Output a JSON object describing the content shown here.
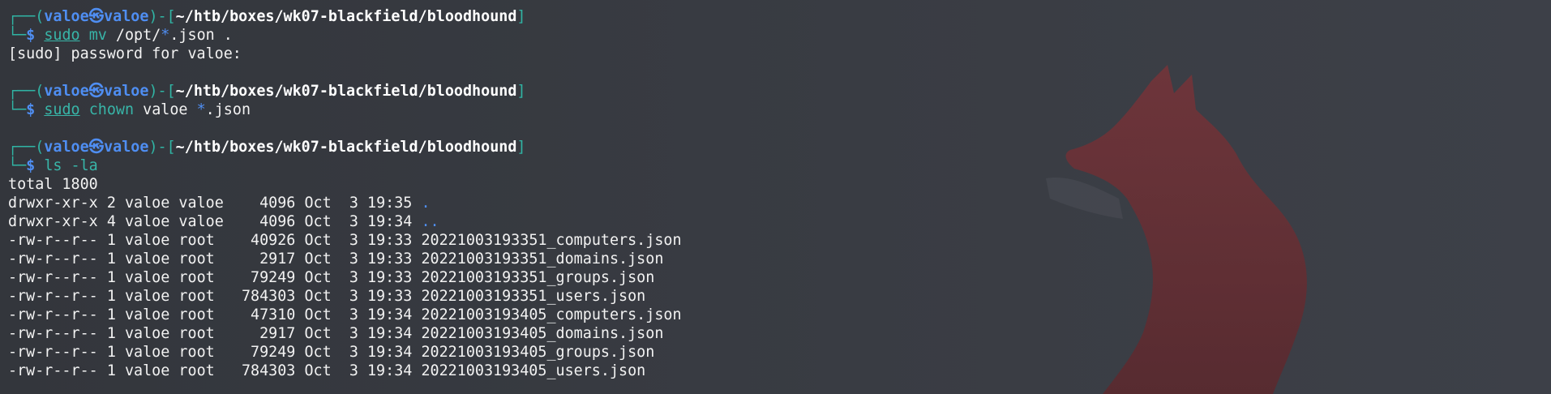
{
  "prompt": {
    "corner_top": "┌──(",
    "user": "valoe",
    "at_symbol": "㉿",
    "host": "valoe",
    "mid": ")-[",
    "cwd": "~/htb/boxes/wk07-blackfield/bloodhound",
    "end": "]",
    "corner_bottom": "└─",
    "dollar": "$ "
  },
  "commands": [
    {
      "parts": [
        {
          "text": "sudo",
          "style": "cmd-ul"
        },
        {
          "text": " ",
          "style": "text"
        },
        {
          "text": "mv",
          "style": "cmd"
        },
        {
          "text": " /opt/",
          "style": "text"
        },
        {
          "text": "*",
          "style": "glob"
        },
        {
          "text": ".json .",
          "style": "text"
        }
      ],
      "output": [
        "[sudo] password for valoe:",
        ""
      ]
    },
    {
      "parts": [
        {
          "text": "sudo",
          "style": "cmd-ul"
        },
        {
          "text": " ",
          "style": "text"
        },
        {
          "text": "chown",
          "style": "cmd"
        },
        {
          "text": " valoe ",
          "style": "text"
        },
        {
          "text": "*",
          "style": "glob"
        },
        {
          "text": ".json",
          "style": "text"
        }
      ],
      "output": [
        ""
      ]
    },
    {
      "parts": [
        {
          "text": "ls -la",
          "style": "cmd"
        }
      ],
      "output": []
    }
  ],
  "listing": {
    "total": "total 1800",
    "entries": [
      {
        "perms": "drwxr-xr-x",
        "links": "2",
        "owner": "valoe",
        "group": "valoe",
        "size": "4096",
        "month": "Oct",
        "day": "3",
        "time": "19:35",
        "name": ".",
        "is_dir": true
      },
      {
        "perms": "drwxr-xr-x",
        "links": "4",
        "owner": "valoe",
        "group": "valoe",
        "size": "4096",
        "month": "Oct",
        "day": "3",
        "time": "19:34",
        "name": "..",
        "is_dir": true
      },
      {
        "perms": "-rw-r--r--",
        "links": "1",
        "owner": "valoe",
        "group": "root",
        "size": "40926",
        "month": "Oct",
        "day": "3",
        "time": "19:33",
        "name": "20221003193351_computers.json",
        "is_dir": false
      },
      {
        "perms": "-rw-r--r--",
        "links": "1",
        "owner": "valoe",
        "group": "root",
        "size": "2917",
        "month": "Oct",
        "day": "3",
        "time": "19:33",
        "name": "20221003193351_domains.json",
        "is_dir": false
      },
      {
        "perms": "-rw-r--r--",
        "links": "1",
        "owner": "valoe",
        "group": "root",
        "size": "79249",
        "month": "Oct",
        "day": "3",
        "time": "19:33",
        "name": "20221003193351_groups.json",
        "is_dir": false
      },
      {
        "perms": "-rw-r--r--",
        "links": "1",
        "owner": "valoe",
        "group": "root",
        "size": "784303",
        "month": "Oct",
        "day": "3",
        "time": "19:33",
        "name": "20221003193351_users.json",
        "is_dir": false
      },
      {
        "perms": "-rw-r--r--",
        "links": "1",
        "owner": "valoe",
        "group": "root",
        "size": "47310",
        "month": "Oct",
        "day": "3",
        "time": "19:34",
        "name": "20221003193405_computers.json",
        "is_dir": false
      },
      {
        "perms": "-rw-r--r--",
        "links": "1",
        "owner": "valoe",
        "group": "root",
        "size": "2917",
        "month": "Oct",
        "day": "3",
        "time": "19:34",
        "name": "20221003193405_domains.json",
        "is_dir": false
      },
      {
        "perms": "-rw-r--r--",
        "links": "1",
        "owner": "valoe",
        "group": "root",
        "size": "79249",
        "month": "Oct",
        "day": "3",
        "time": "19:34",
        "name": "20221003193405_groups.json",
        "is_dir": false
      },
      {
        "perms": "-rw-r--r--",
        "links": "1",
        "owner": "valoe",
        "group": "root",
        "size": "784303",
        "month": "Oct",
        "day": "3",
        "time": "19:34",
        "name": "20221003193405_users.json",
        "is_dir": false
      }
    ]
  },
  "colors": {
    "background": "#3a3d44",
    "prompt_frame": "#30b4a4",
    "user_host": "#4f8ef2",
    "command": "#38b5a8",
    "directory": "#4f8ef2",
    "text": "#f2f2f2",
    "wallpaper_fox": "#6e2f33"
  },
  "wallpaper": {
    "icon": "fox-silhouette-icon"
  }
}
